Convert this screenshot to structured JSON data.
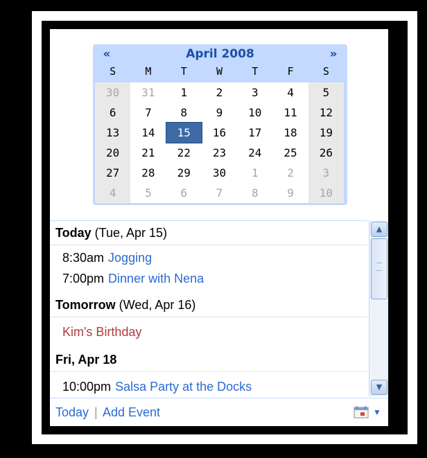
{
  "calendar": {
    "title": "April 2008",
    "prev": "«",
    "next": "»",
    "days_of_week": [
      "S",
      "M",
      "T",
      "W",
      "T",
      "F",
      "S"
    ],
    "weeks": [
      [
        {
          "d": "30",
          "o": true
        },
        {
          "d": "31",
          "o": true
        },
        {
          "d": "1"
        },
        {
          "d": "2"
        },
        {
          "d": "3"
        },
        {
          "d": "4"
        },
        {
          "d": "5"
        }
      ],
      [
        {
          "d": "6"
        },
        {
          "d": "7"
        },
        {
          "d": "8"
        },
        {
          "d": "9"
        },
        {
          "d": "10"
        },
        {
          "d": "11"
        },
        {
          "d": "12"
        }
      ],
      [
        {
          "d": "13"
        },
        {
          "d": "14"
        },
        {
          "d": "15",
          "today": true
        },
        {
          "d": "16"
        },
        {
          "d": "17"
        },
        {
          "d": "18"
        },
        {
          "d": "19"
        }
      ],
      [
        {
          "d": "20"
        },
        {
          "d": "21"
        },
        {
          "d": "22"
        },
        {
          "d": "23"
        },
        {
          "d": "24"
        },
        {
          "d": "25"
        },
        {
          "d": "26"
        }
      ],
      [
        {
          "d": "27"
        },
        {
          "d": "28"
        },
        {
          "d": "29"
        },
        {
          "d": "30"
        },
        {
          "d": "1",
          "o": true
        },
        {
          "d": "2",
          "o": true
        },
        {
          "d": "3",
          "o": true
        }
      ],
      [
        {
          "d": "4",
          "o": true
        },
        {
          "d": "5",
          "o": true
        },
        {
          "d": "6",
          "o": true
        },
        {
          "d": "7",
          "o": true
        },
        {
          "d": "8",
          "o": true
        },
        {
          "d": "9",
          "o": true
        },
        {
          "d": "10",
          "o": true
        }
      ]
    ]
  },
  "agenda": {
    "today_label": "Today",
    "today_date": " (Tue, Apr 15)",
    "today_events": [
      {
        "time": "8:30am",
        "title": "Jogging"
      },
      {
        "time": "7:00pm",
        "title": "Dinner with Nena"
      }
    ],
    "tomorrow_label": "Tomorrow",
    "tomorrow_date": " (Wed, Apr 16)",
    "tomorrow_events": [
      {
        "title": "Kim's Birthday"
      }
    ],
    "fri_label": "Fri, Apr 18",
    "fri_events": [
      {
        "time": "10:00pm",
        "title": "Salsa Party at the Docks"
      }
    ]
  },
  "footer": {
    "today": "Today",
    "separator": "|",
    "add_event": "Add Event"
  },
  "colors": {
    "link": "#2a6bd1",
    "birthday": "#b13a3a",
    "calendar_bg": "#c3d9ff",
    "today_cell": "#3e6aa6"
  },
  "icons": {
    "prev": "double-left-arrow-icon",
    "next": "double-right-arrow-icon",
    "scroll_up": "chevron-up-icon",
    "scroll_down": "chevron-down-icon",
    "calendar": "calendar-icon",
    "menu": "caret-down-icon"
  }
}
